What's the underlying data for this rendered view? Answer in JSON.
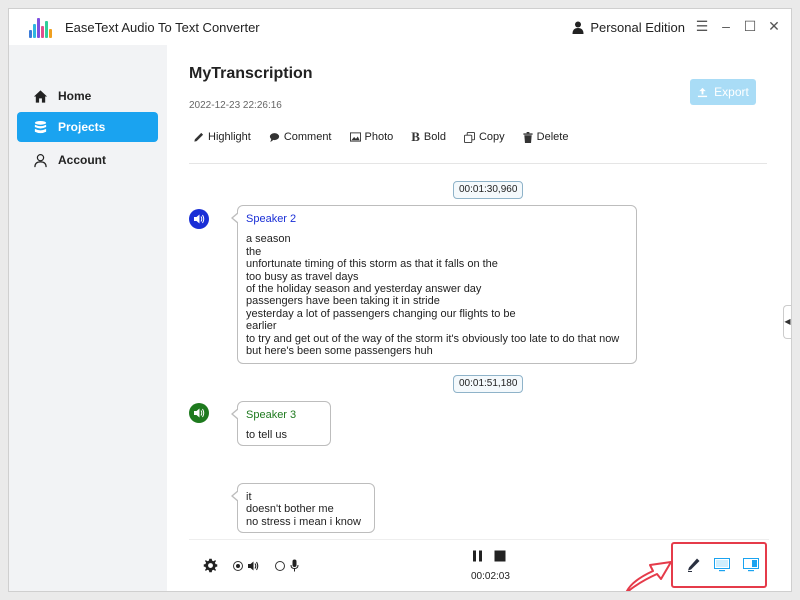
{
  "app": {
    "title": "EaseText Audio To Text Converter",
    "edition": "Personal Edition",
    "accent_color": "#1aa3f0"
  },
  "window_controls": [
    "menu-icon",
    "minimize-icon",
    "maximize-icon",
    "close-icon"
  ],
  "sidebar": {
    "items": [
      {
        "label": "Home",
        "icon": "home-icon",
        "active": false
      },
      {
        "label": "Projects",
        "icon": "database-icon",
        "active": true
      },
      {
        "label": "Account",
        "icon": "user-icon",
        "active": false
      }
    ]
  },
  "document": {
    "title": "MyTranscription",
    "date": "2022-12-23 22:26:16",
    "export_label": "Export"
  },
  "toolbar": {
    "highlight": "Highlight",
    "comment": "Comment",
    "photo": "Photo",
    "bold": "Bold",
    "copy": "Copy",
    "delete": "Delete"
  },
  "transcript": [
    {
      "timestamp": "00:01:30,960",
      "speaker": "Speaker 2",
      "speaker_color": "#1a2fd6",
      "lines": [
        "a season",
        "the",
        "unfortunate timing of this storm as that it falls on the",
        "too busy as travel days",
        "of the holiday season and yesterday answer day",
        "passengers have been taking it in stride",
        "yesterday a lot of passengers changing our flights to be",
        "earlier",
        "to try and get out of the way of the storm it's obviously too late to do that now",
        "but here's been some passengers huh"
      ]
    },
    {
      "timestamp": "00:01:51,180",
      "speaker": "Speaker 3",
      "speaker_color": "#1e7a1e",
      "lines": [
        "to tell us"
      ]
    },
    {
      "timestamp": "",
      "speaker": "",
      "lines": [
        "it",
        "doesn't bother me",
        "no stress i mean i know"
      ]
    }
  ],
  "playback": {
    "elapsed": "00:02:03",
    "source_speaker_selected": true,
    "source_mic_selected": false
  }
}
